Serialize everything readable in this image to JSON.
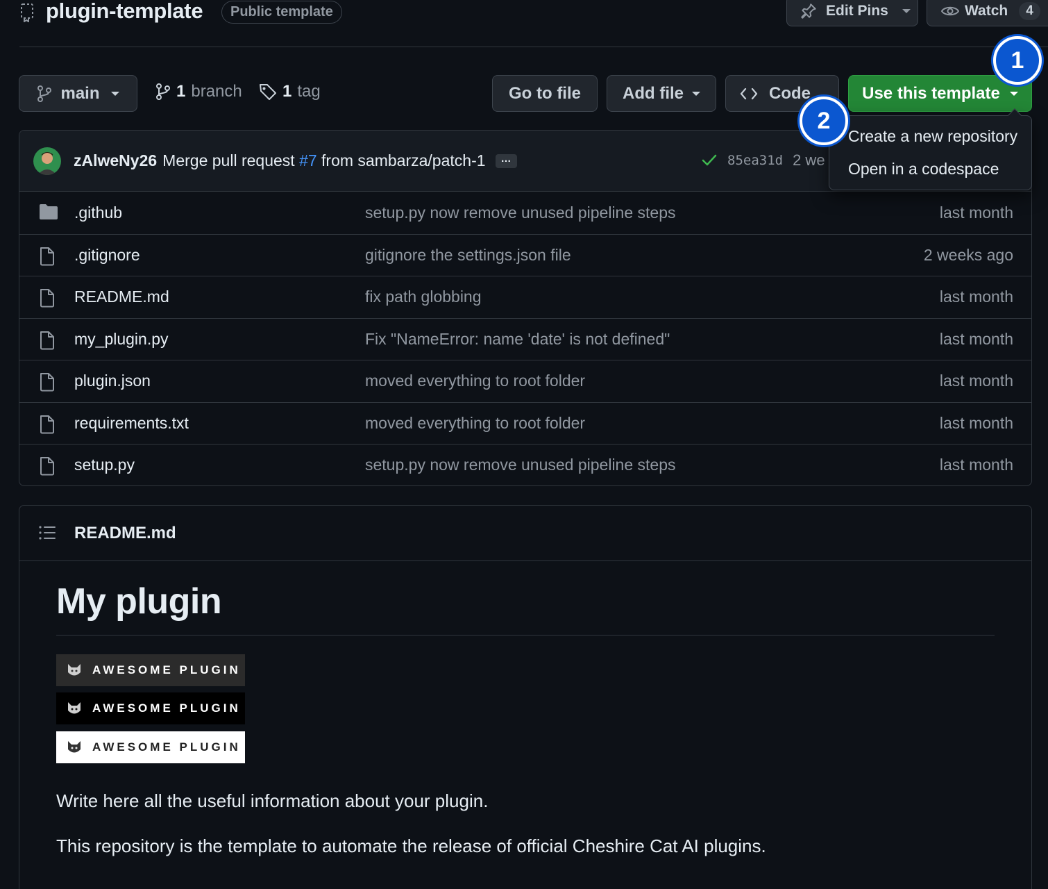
{
  "repo": {
    "name": "plugin-template",
    "visibility": "Public template"
  },
  "header_actions": {
    "edit_pins": "Edit Pins",
    "watch": "Watch",
    "watch_count": "4"
  },
  "toolbar": {
    "branch": "main",
    "branch_count": "1",
    "branch_label": "branch",
    "tag_count": "1",
    "tag_label": "tag",
    "go_to_file": "Go to file",
    "add_file": "Add file",
    "code": "Code",
    "use_template": "Use this template"
  },
  "template_menu": {
    "items": [
      "Create a new repository",
      "Open in a codespace"
    ]
  },
  "step_markers": [
    "1",
    "2"
  ],
  "latest_commit": {
    "author": "zAlweNy26",
    "message_prefix": "Merge pull request",
    "pr": "#7",
    "message_suffix": "from sambarza/patch-1",
    "ellipsis": "…",
    "sha": "85ea31d",
    "time": "2 we"
  },
  "files": [
    {
      "name": ".github",
      "type": "folder",
      "message": "setup.py now remove unused pipeline steps",
      "time": "last month"
    },
    {
      "name": ".gitignore",
      "type": "file",
      "message": "gitignore the settings.json file",
      "time": "2 weeks ago"
    },
    {
      "name": "README.md",
      "type": "file",
      "message": "fix path globbing",
      "time": "last month"
    },
    {
      "name": "my_plugin.py",
      "type": "file",
      "message": "Fix \"NameError: name 'date' is not defined\"",
      "time": "last month"
    },
    {
      "name": "plugin.json",
      "type": "file",
      "message": "moved everything to root folder",
      "time": "last month"
    },
    {
      "name": "requirements.txt",
      "type": "file",
      "message": "moved everything to root folder",
      "time": "last month"
    },
    {
      "name": "setup.py",
      "type": "file",
      "message": "setup.py now remove unused pipeline steps",
      "time": "last month"
    }
  ],
  "readme": {
    "file_title": "README.md",
    "heading": "My plugin",
    "badges": [
      "AWESOME PLUGIN",
      "AWESOME PLUGIN",
      "AWESOME PLUGIN"
    ],
    "paragraphs": [
      "Write here all the useful information about your plugin.",
      "This repository is the template to automate the release of official Cheshire Cat AI plugins."
    ]
  },
  "colors": {
    "background": "#0d1117",
    "primary_button": "#238636",
    "link": "#4493f8",
    "success": "#3fb950",
    "marker": "#0b57d0"
  },
  "icons": [
    "repo-template-icon",
    "pin-icon",
    "eye-icon",
    "git-branch-icon",
    "tag-icon",
    "code-icon",
    "check-icon",
    "folder-icon",
    "file-icon",
    "list-icon",
    "cat-icon"
  ]
}
